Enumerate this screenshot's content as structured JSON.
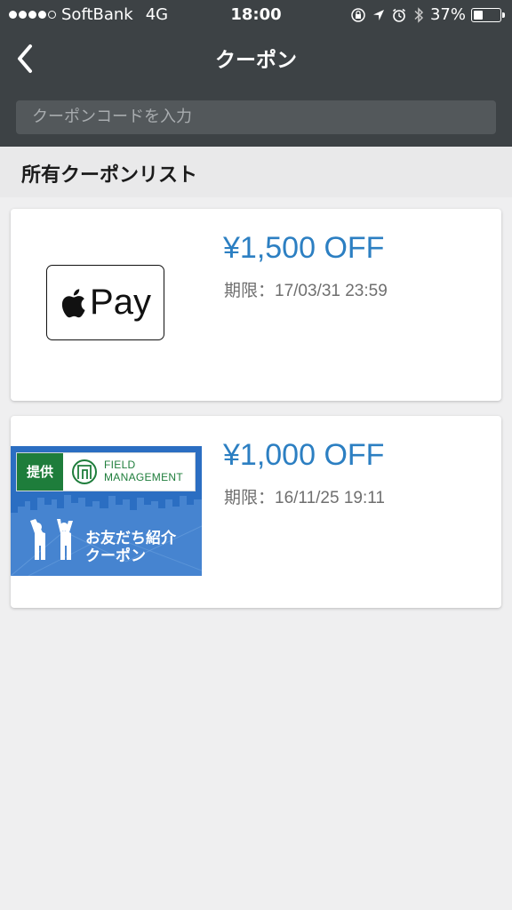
{
  "status_bar": {
    "carrier": "SoftBank",
    "network": "4G",
    "time": "18:00",
    "battery_percent_label": "37%",
    "battery_level": 0.37,
    "signal_dots_filled": 4,
    "icons": [
      "orientation-lock-icon",
      "location-arrow-icon",
      "alarm-icon",
      "bluetooth-icon",
      "battery-icon"
    ]
  },
  "navbar": {
    "title": "クーポン",
    "back_icon": "chevron-left-icon"
  },
  "search": {
    "placeholder": "クーポンコードを入力"
  },
  "section": {
    "title": "所有クーポンリスト"
  },
  "coupons": [
    {
      "amount": "¥1,500 OFF",
      "deadline": "期限：17/03/31 23:59",
      "image": "apple-pay-logo",
      "logo_text": "Pay"
    },
    {
      "amount": "¥1,000 OFF",
      "deadline": "期限：16/11/25 19:11",
      "image": "field-management-banner",
      "banner": {
        "badge": "提供",
        "brand_line1": "FIELD",
        "brand_line2": "MANAGEMENT",
        "caption_line1": "お友だち紹介",
        "caption_line2": "クーポン"
      }
    }
  ],
  "colors": {
    "header_bg": "#3d4245",
    "accent_blue": "#2c7fc2",
    "brand_green": "#1e7d3b",
    "page_bg": "#efeff0"
  }
}
